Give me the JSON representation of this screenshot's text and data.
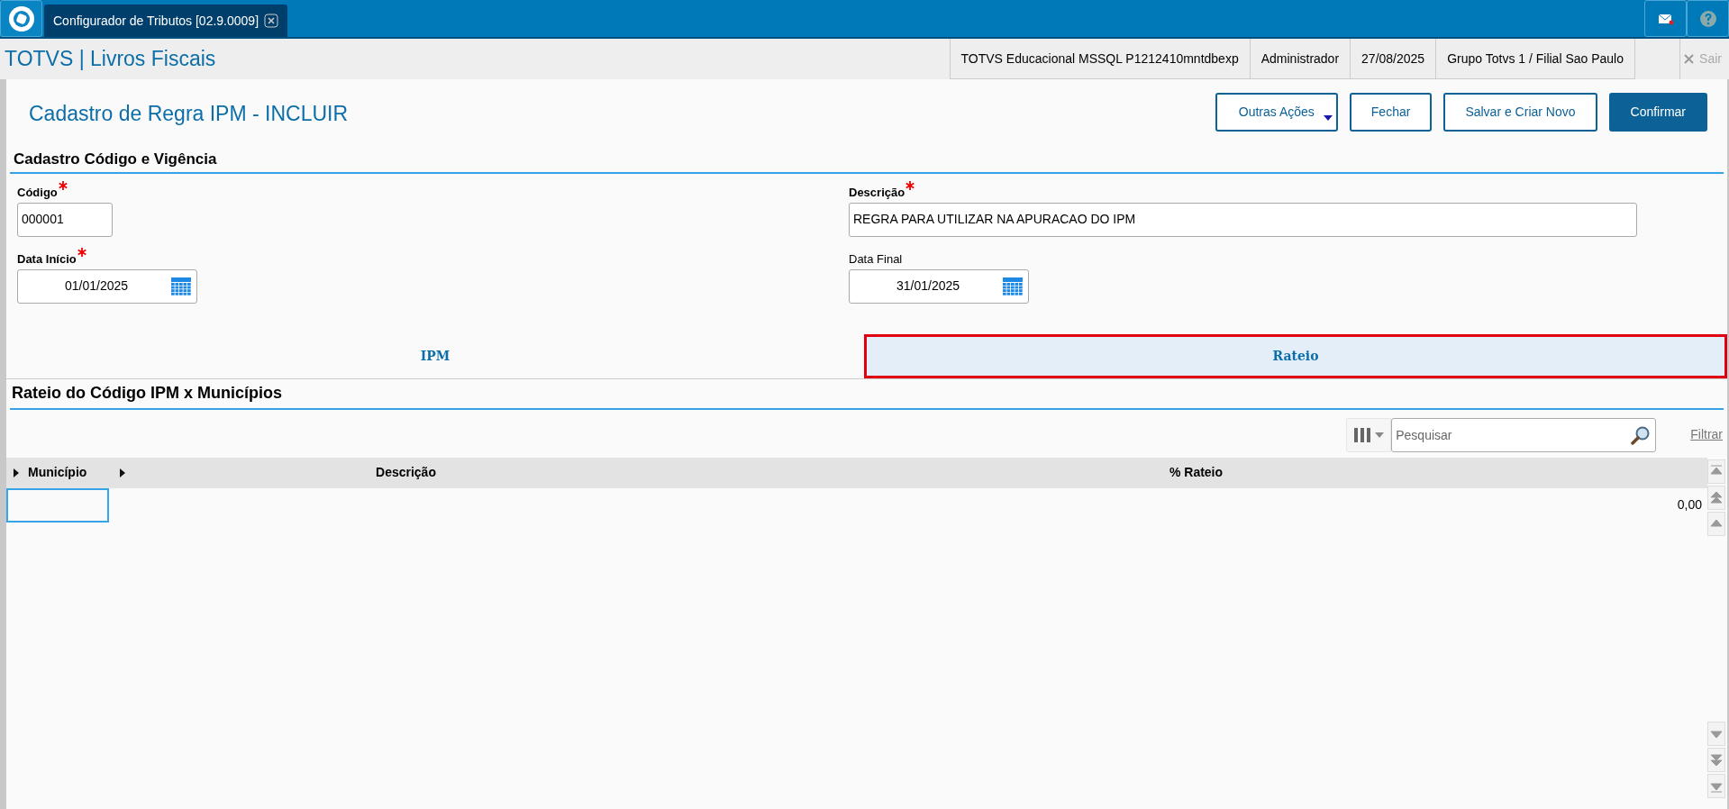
{
  "app_tab": {
    "title": "Configurador de Tributos [02.9.0009]"
  },
  "header": {
    "title": "TOTVS | Livros Fiscais",
    "info": [
      "TOTVS Educacional MSSQL P1212410mntdbexp",
      "Administrador",
      "27/08/2025",
      "Grupo Totvs 1 / Filial Sao Paulo"
    ],
    "exit": "Sair"
  },
  "page_title": "Cadastro de Regra IPM - INCLUIR",
  "actions": [
    {
      "label": "Outras Ações",
      "kind": "menu"
    },
    {
      "label": "Fechar",
      "kind": "outline"
    },
    {
      "label": "Salvar e Criar Novo",
      "kind": "outline"
    },
    {
      "label": "Confirmar",
      "kind": "primary"
    }
  ],
  "section1": {
    "title": "Cadastro Código e Vigência"
  },
  "fields": [
    {
      "label": "Código",
      "value": "000001",
      "required": true,
      "kind": "text"
    },
    {
      "label": "Descrição",
      "value": "REGRA PARA UTILIZAR NA APURACAO DO IPM",
      "required": true,
      "kind": "text"
    },
    {
      "label": "Data Início",
      "value": "01/01/2025",
      "required": true,
      "kind": "date"
    },
    {
      "label": "Data Final",
      "value": "31/01/2025",
      "required": false,
      "kind": "date"
    }
  ],
  "tabs": [
    {
      "label": "IPM",
      "selected": false,
      "highlighted": false
    },
    {
      "label": "Rateio",
      "selected": true,
      "highlighted": true
    }
  ],
  "section2": {
    "title": "Rateio do Código IPM x Municípios"
  },
  "search": {
    "placeholder": "Pesquisar"
  },
  "filter_link": "Filtrar",
  "table": {
    "columns": [
      "Município",
      "Descrição",
      "% Rateio"
    ],
    "rows": [
      {
        "cells": [
          "",
          "",
          "0,00"
        ]
      }
    ]
  }
}
